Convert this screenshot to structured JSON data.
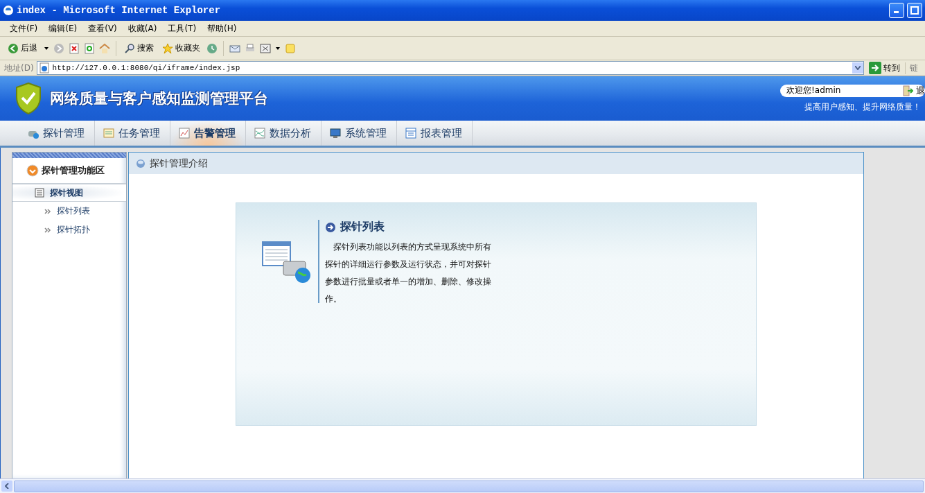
{
  "window": {
    "title": "index - Microsoft Internet Explorer"
  },
  "menu_bar": [
    "文件(F)",
    "编辑(E)",
    "查看(V)",
    "收藏(A)",
    "工具(T)",
    "帮助(H)"
  ],
  "toolbar": {
    "back": "后退",
    "search": "搜索",
    "favorites": "收藏夹"
  },
  "address_bar": {
    "label": "地址(D)",
    "url": "http://127.0.0.1:8080/qi/iframe/index.jsp",
    "go": "转到",
    "links": "链"
  },
  "app_header": {
    "title": "网络质量与客户感知监测管理平台",
    "welcome": "欢迎您!admin",
    "logout": "退",
    "slogan": "提高用户感知、提升网络质量！"
  },
  "nav_tabs": [
    {
      "label": "探针管理",
      "selected": false
    },
    {
      "label": "任务管理",
      "selected": false
    },
    {
      "label": "告警管理",
      "selected": true
    },
    {
      "label": "数据分析",
      "selected": false
    },
    {
      "label": "系统管理",
      "selected": false
    },
    {
      "label": "报表管理",
      "selected": false
    }
  ],
  "sidebar": {
    "title": "探针管理功能区",
    "groups": [
      {
        "label": "探针视图",
        "children": [
          {
            "label": "探针列表"
          },
          {
            "label": "探针拓扑"
          }
        ]
      }
    ]
  },
  "panel": {
    "title": "探针管理介绍",
    "card": {
      "heading": "探针列表",
      "description": "探针列表功能以列表的方式呈现系统中所有探针的详细运行参数及运行状态，并可对探针参数进行批量或者单一的增加、删除、修改操作。"
    }
  }
}
